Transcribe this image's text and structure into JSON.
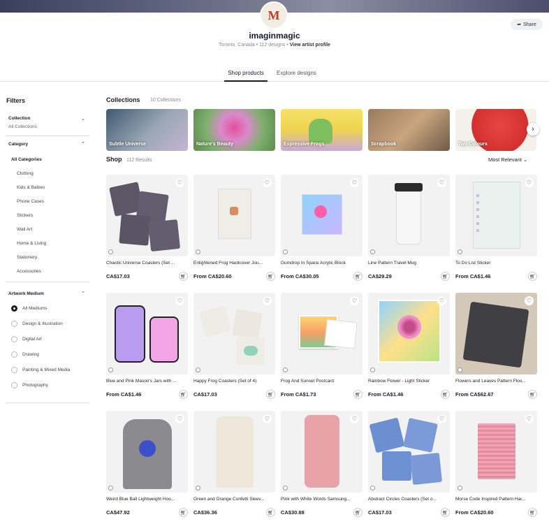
{
  "header": {
    "artist_name": "imaginmagic",
    "location": "Toronto, Canada",
    "designs": "112 designs",
    "profile_link": "View artist profile",
    "share_label": "Share",
    "avatar_letter": "M"
  },
  "tabs": [
    {
      "label": "Shop products",
      "active": true
    },
    {
      "label": "Explore designs",
      "active": false
    }
  ],
  "filters": {
    "title": "Filters",
    "collection": {
      "label": "Collection",
      "value": "All Collections"
    },
    "category": {
      "label": "Category",
      "all": "All Categories",
      "items": [
        "Clothing",
        "Kids & Babies",
        "Phone Cases",
        "Stickers",
        "Wall Art",
        "Home & Living",
        "Stationery",
        "Accessories"
      ]
    },
    "medium": {
      "label": "Artwork Medium",
      "items": [
        "All Mediums",
        "Design & Illustration",
        "Digital Art",
        "Drawing",
        "Painting & Mixed Media",
        "Photography"
      ],
      "selected": "All Mediums"
    }
  },
  "collections": {
    "title": "Collections",
    "count": "10 Collections",
    "items": [
      {
        "label": "Subtle Universe",
        "color": "#7f8fa6"
      },
      {
        "label": "Nature's Beauty",
        "color": "#c97bb0"
      },
      {
        "label": "Expressive Frogs",
        "color": "#e6c84a"
      },
      {
        "label": "Scrapbook",
        "color": "#b48b66"
      },
      {
        "label": "Two Colours",
        "color": "#d93a3a"
      }
    ]
  },
  "shop": {
    "title": "Shop",
    "count": "112 Results",
    "sort": "Most Relevant",
    "products": [
      {
        "name": "Chaotic Universe Coasters (Set ...",
        "price": "CA$17.03",
        "art": "coasters-dark"
      },
      {
        "name": "Enlightened Frog Hardcover Jou...",
        "price": "From CA$20.60",
        "art": "journal"
      },
      {
        "name": "Gumdrop In Space Acrylic Block",
        "price": "From CA$30.05",
        "art": "acrylic"
      },
      {
        "name": "Line Pattern Travel Mug",
        "price": "CA$29.29",
        "art": "mug"
      },
      {
        "name": "To Do List Sticker",
        "price": "From CA$1.46",
        "art": "todo"
      },
      {
        "name": "Blue and Pink Mason's Jars with ...",
        "price": "From CA$1.46",
        "art": "jars"
      },
      {
        "name": "Happy Frog Coasters (Set of 4)",
        "price": "CA$17.03",
        "art": "coasters-light"
      },
      {
        "name": "Frog And Sunset Postcard",
        "price": "From CA$1.73",
        "art": "postcard"
      },
      {
        "name": "Rainbow Flower - Light Sticker",
        "price": "From CA$1.46",
        "art": "flower"
      },
      {
        "name": "Flowers and Leaves Pattern Floo...",
        "price": "From CA$62.67",
        "art": "pillow"
      },
      {
        "name": "Weird Blue Ball Lightweight Hoo...",
        "price": "CA$47.92",
        "art": "hoodie"
      },
      {
        "name": "Green and Orange Confetti Sleev...",
        "price": "CA$36.36",
        "art": "tank"
      },
      {
        "name": "Pink with White Words Samsung...",
        "price": "CA$30.88",
        "art": "phone"
      },
      {
        "name": "Abstract Circles Coasters (Set o...",
        "price": "CA$17.03",
        "art": "coasters-blue"
      },
      {
        "name": "Morse Code Inspired Pattern Har...",
        "price": "From CA$20.60",
        "art": "journal-pink"
      }
    ]
  },
  "colors": {
    "accent": "#1a1a2e",
    "thumb_bg": "#f2f2f2"
  }
}
